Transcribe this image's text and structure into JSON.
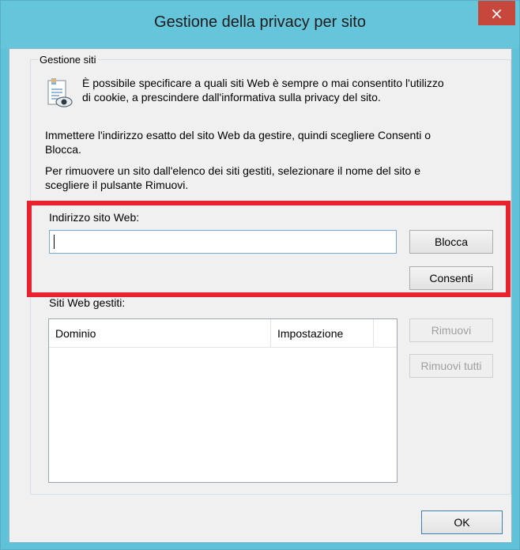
{
  "window": {
    "title": "Gestione della privacy per sito",
    "close_glyph": "×"
  },
  "group": {
    "label": "Gestione siti",
    "description_line1": "È possibile specificare a quali siti Web è sempre o mai consentito l'utilizzo",
    "description_line2": "di cookie, a prescindere dall'informativa sulla privacy del sito.",
    "icon": "privacy-document-icon"
  },
  "instructions": {
    "line1": "Immettere l'indirizzo esatto del sito Web da gestire, quindi scegliere Consenti o",
    "line2": "Blocca.",
    "line3": "Per rimuovere un sito dall'elenco dei siti gestiti, selezionare il nome del sito e",
    "line4": "scegliere il pulsante Rimuovi."
  },
  "address": {
    "label": "Indirizzo sito Web:",
    "value": ""
  },
  "buttons": {
    "block": "Blocca",
    "allow": "Consenti",
    "remove": "Rimuovi",
    "remove_all": "Rimuovi tutti",
    "ok": "OK"
  },
  "managed": {
    "label": "Siti Web gestiti:",
    "columns": [
      "Dominio",
      "Impostazione"
    ],
    "rows": []
  },
  "colors": {
    "titlebar": "#65c5db",
    "close": "#c7473c",
    "highlight": "#e8232d"
  }
}
